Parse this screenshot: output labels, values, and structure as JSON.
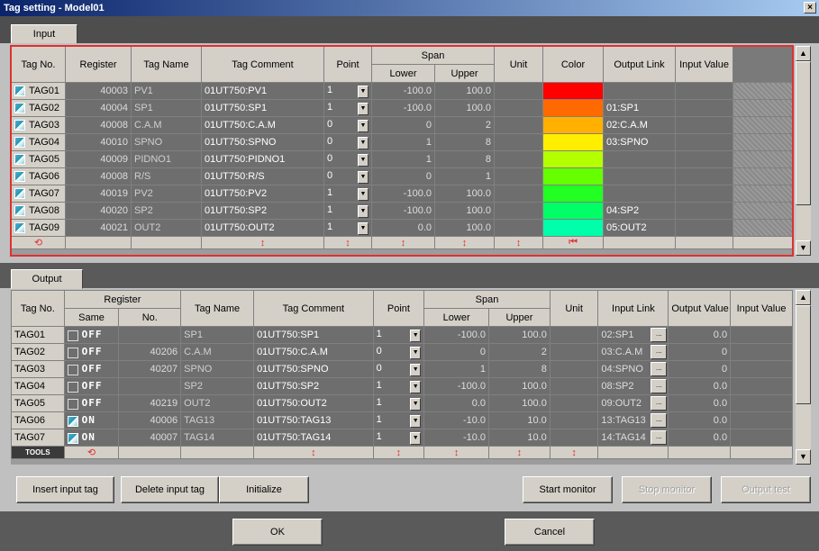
{
  "window": {
    "title": "Tag setting - Model01",
    "close": "×"
  },
  "input": {
    "tab": "Input",
    "headers": {
      "tag_no": "Tag No.",
      "register": "Register",
      "tag_name": "Tag Name",
      "tag_comment": "Tag Comment",
      "point": "Point",
      "span": "Span",
      "lower": "Lower",
      "upper": "Upper",
      "unit": "Unit",
      "color": "Color",
      "output_link": "Output Link",
      "input_value": "Input Value"
    },
    "rows": [
      {
        "tag": "TAG01",
        "register": "40003",
        "name": "PV1",
        "comment": "01UT750:PV1",
        "point": "1",
        "lower": "-100.0",
        "upper": "100.0",
        "unit": "",
        "color": "#ff0000",
        "link": "",
        "value": ""
      },
      {
        "tag": "TAG02",
        "register": "40004",
        "name": "SP1",
        "comment": "01UT750:SP1",
        "point": "1",
        "lower": "-100.0",
        "upper": "100.0",
        "unit": "",
        "color": "#ff6a00",
        "link": "01:SP1",
        "value": ""
      },
      {
        "tag": "TAG03",
        "register": "40008",
        "name": "C.A.M",
        "comment": "01UT750:C.A.M",
        "point": "0",
        "lower": "0",
        "upper": "2",
        "unit": "",
        "color": "#ffb000",
        "link": "02:C.A.M",
        "value": ""
      },
      {
        "tag": "TAG04",
        "register": "40010",
        "name": "SPNO",
        "comment": "01UT750:SPNO",
        "point": "0",
        "lower": "1",
        "upper": "8",
        "unit": "",
        "color": "#ffee00",
        "link": "03:SPNO",
        "value": ""
      },
      {
        "tag": "TAG05",
        "register": "40009",
        "name": "PIDNO1",
        "comment": "01UT750:PIDNO1",
        "point": "0",
        "lower": "1",
        "upper": "8",
        "unit": "",
        "color": "#b4ff00",
        "link": "",
        "value": ""
      },
      {
        "tag": "TAG06",
        "register": "40008",
        "name": "R/S",
        "comment": "01UT750:R/S",
        "point": "0",
        "lower": "0",
        "upper": "1",
        "unit": "",
        "color": "#66ff00",
        "link": "",
        "value": ""
      },
      {
        "tag": "TAG07",
        "register": "40019",
        "name": "PV2",
        "comment": "01UT750:PV2",
        "point": "1",
        "lower": "-100.0",
        "upper": "100.0",
        "unit": "",
        "color": "#22ff22",
        "link": "",
        "value": ""
      },
      {
        "tag": "TAG08",
        "register": "40020",
        "name": "SP2",
        "comment": "01UT750:SP2",
        "point": "1",
        "lower": "-100.0",
        "upper": "100.0",
        "unit": "",
        "color": "#00ff66",
        "link": "04:SP2",
        "value": ""
      },
      {
        "tag": "TAG09",
        "register": "40021",
        "name": "OUT2",
        "comment": "01UT750:OUT2",
        "point": "1",
        "lower": "0.0",
        "upper": "100.0",
        "unit": "",
        "color": "#00ffaa",
        "link": "05:OUT2",
        "value": ""
      }
    ],
    "icons": [
      "trend-icon",
      "checkbox-icon",
      "sort-arrow-icon",
      "color-marker-icon"
    ]
  },
  "output": {
    "tab": "Output",
    "headers": {
      "tag_no": "Tag No.",
      "register": "Register",
      "same": "Same",
      "no": "No.",
      "tag_name": "Tag Name",
      "tag_comment": "Tag Comment",
      "point": "Point",
      "span": "Span",
      "lower": "Lower",
      "upper": "Upper",
      "unit": "Unit",
      "input_link": "Input Link",
      "output_value": "Output Value",
      "input_value": "Input Value"
    },
    "rows": [
      {
        "tag": "TAG01",
        "same": "OFF",
        "same_checked": false,
        "no": "",
        "name": "SP1",
        "comment": "01UT750:SP1",
        "point": "1",
        "lower": "-100.0",
        "upper": "100.0",
        "unit": "",
        "link": "02:SP1",
        "out": "0.0",
        "in": ""
      },
      {
        "tag": "TAG02",
        "same": "OFF",
        "same_checked": false,
        "no": "40206",
        "name": "C.A.M",
        "comment": "01UT750:C.A.M",
        "point": "0",
        "lower": "0",
        "upper": "2",
        "unit": "",
        "link": "03:C.A.M",
        "out": "0",
        "in": ""
      },
      {
        "tag": "TAG03",
        "same": "OFF",
        "same_checked": false,
        "no": "40207",
        "name": "SPNO",
        "comment": "01UT750:SPNO",
        "point": "0",
        "lower": "1",
        "upper": "8",
        "unit": "",
        "link": "04:SPNO",
        "out": "0",
        "in": ""
      },
      {
        "tag": "TAG04",
        "same": "OFF",
        "same_checked": false,
        "no": "",
        "name": "SP2",
        "comment": "01UT750:SP2",
        "point": "1",
        "lower": "-100.0",
        "upper": "100.0",
        "unit": "",
        "link": "08:SP2",
        "out": "0.0",
        "in": ""
      },
      {
        "tag": "TAG05",
        "same": "OFF",
        "same_checked": false,
        "no": "40219",
        "name": "OUT2",
        "comment": "01UT750:OUT2",
        "point": "1",
        "lower": "0.0",
        "upper": "100.0",
        "unit": "",
        "link": "09:OUT2",
        "out": "0.0",
        "in": ""
      },
      {
        "tag": "TAG06",
        "same": "ON",
        "same_checked": true,
        "no": "40006",
        "name": "TAG13",
        "comment": "01UT750:TAG13",
        "point": "1",
        "lower": "-10.0",
        "upper": "10.0",
        "unit": "",
        "link": "13:TAG13",
        "out": "0.0",
        "in": ""
      },
      {
        "tag": "TAG07",
        "same": "ON",
        "same_checked": true,
        "no": "40007",
        "name": "TAG14",
        "comment": "01UT750:TAG14",
        "point": "1",
        "lower": "-10.0",
        "upper": "10.0",
        "unit": "",
        "link": "14:TAG14",
        "out": "0.0",
        "in": ""
      }
    ],
    "tools_label": "TOOLS",
    "link_button": "..."
  },
  "toolbar": {
    "insert": "Insert input tag",
    "delete": "Delete input tag",
    "initialize": "Initialize",
    "start_monitor": "Start monitor",
    "stop_monitor": "Stop monitor",
    "output_test": "Output test"
  },
  "footer": {
    "ok": "OK",
    "cancel": "Cancel"
  }
}
